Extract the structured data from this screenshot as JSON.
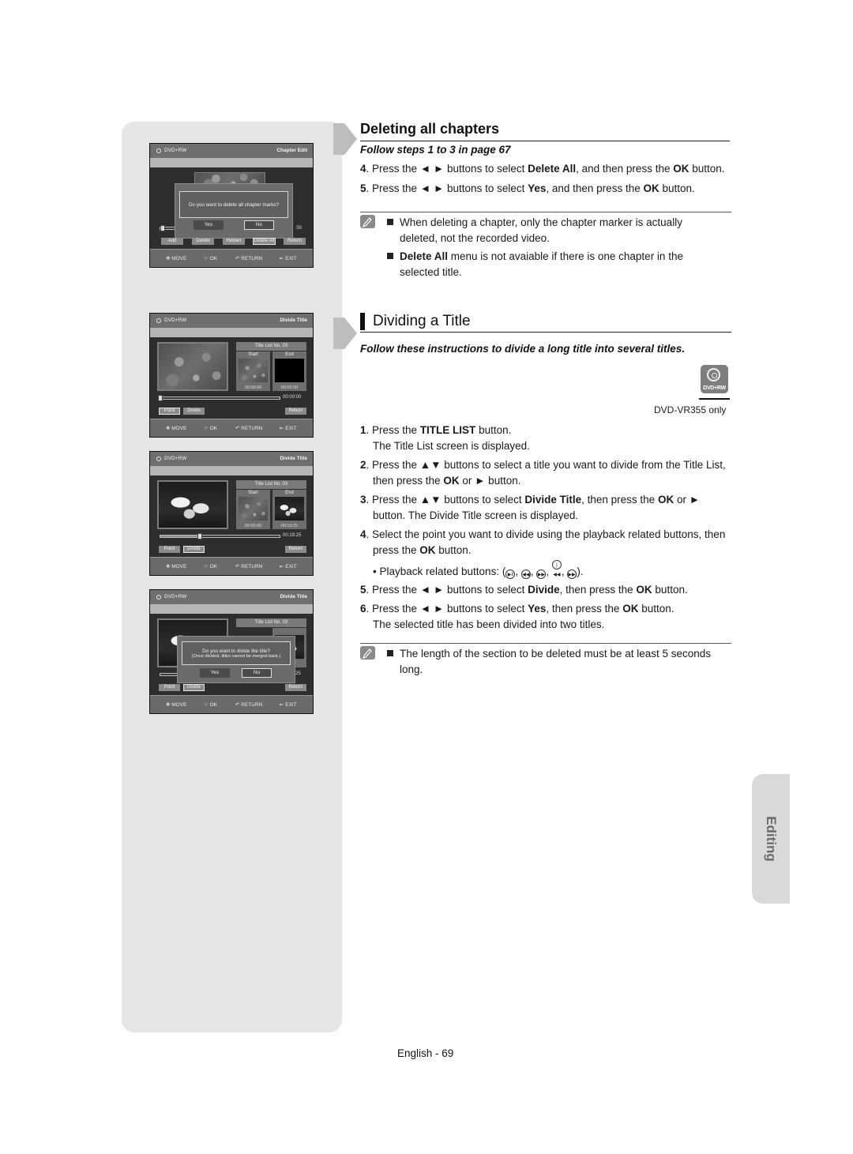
{
  "sidebar_screens": [
    {
      "disc": "DVD+RW",
      "title": "Chapter Edit",
      "dialog": {
        "message_lines": [
          "Do you want to delete all chapter marks?"
        ],
        "yes": "Yes",
        "no": "No",
        "selected": "No"
      },
      "buttons": [
        "Add",
        "Delete",
        "Hidden",
        "Delete All",
        "Return"
      ],
      "selected_button": "Delete All",
      "time_fragment": "00",
      "nav": {
        "move": "MOVE",
        "ok": "OK",
        "return": "RETURN",
        "exit": "EXIT"
      }
    },
    {
      "disc": "DVD+RW",
      "title": "Divide Title",
      "title_list": "Title List No. 03",
      "start_label": "Start",
      "end_label": "End",
      "start_time": "00:00:00",
      "end_time": "00:00:00",
      "current_time": "00:00:00",
      "progress": 0.0,
      "buttons": [
        "Point",
        "Divide",
        "Return"
      ],
      "selected_button": "Point",
      "nav": {
        "move": "MOVE",
        "ok": "OK",
        "return": "RETURN",
        "exit": "EXIT"
      }
    },
    {
      "disc": "DVD+RW",
      "title": "Divide Title",
      "title_list": "Title List No. 03",
      "start_label": "Start",
      "end_label": "End",
      "start_time": "00:00:00",
      "end_time": "00:19:25",
      "current_time": "00:19:25",
      "progress": 0.33,
      "buttons": [
        "Point",
        "Divide",
        "Return"
      ],
      "selected_button": "Divide",
      "nav": {
        "move": "MOVE",
        "ok": "OK",
        "return": "RETURN",
        "exit": "EXIT"
      }
    },
    {
      "disc": "DVD+RW",
      "title": "Divide Title",
      "title_list": "Title List No. 03",
      "dialog": {
        "message_lines": [
          "Do you want to divide the title?",
          "(Once divided, titles cannot be merged back.)"
        ],
        "yes": "Yes",
        "no": "No",
        "selected": "No"
      },
      "time_fragment": "25",
      "buttons": [
        "Point",
        "Divide",
        "Return"
      ],
      "selected_button": "Divide",
      "nav": {
        "move": "MOVE",
        "ok": "OK",
        "return": "RETURN",
        "exit": "EXIT"
      }
    }
  ],
  "section1": {
    "heading": "Deleting all chapters",
    "subheading": "Follow steps 1 to 3 in page 67",
    "steps": [
      {
        "num": "4",
        "parts": [
          [
            "t",
            "Press the ◄ ► buttons to select "
          ],
          [
            "b",
            "Delete All"
          ],
          [
            "t",
            ", and then press the "
          ],
          [
            "b",
            "OK"
          ],
          [
            "t",
            " button."
          ]
        ]
      },
      {
        "num": "5",
        "parts": [
          [
            "t",
            "Press the ◄ ► buttons to select "
          ],
          [
            "b",
            "Yes"
          ],
          [
            "t",
            ", and then press the "
          ],
          [
            "b",
            "OK"
          ],
          [
            "t",
            " button."
          ]
        ]
      }
    ],
    "notes": [
      {
        "parts": [
          [
            "t",
            "When deleting a chapter, only the chapter marker is actually deleted, not the recorded video."
          ]
        ]
      },
      {
        "parts": [
          [
            "b",
            "Delete All"
          ],
          [
            "t",
            " menu is not avaiable if there is one chapter in the selected title."
          ]
        ]
      }
    ]
  },
  "section2": {
    "heading": "Dividing a Title",
    "subheading": "Follow these instructions to divide a long title into several titles.",
    "badge_label": "DVD+RW",
    "model_note": "DVD-VR355 only",
    "steps": [
      {
        "num": "1",
        "parts": [
          [
            "t",
            "Press the "
          ],
          [
            "b",
            "TITLE LIST"
          ],
          [
            "t",
            " button."
          ],
          [
            "br",
            ""
          ],
          [
            "t",
            "The Title List screen is displayed."
          ]
        ]
      },
      {
        "num": "2",
        "parts": [
          [
            "t",
            "Press the ▲▼ buttons to select a title you want to divide from the Title List, then press the "
          ],
          [
            "b",
            "OK"
          ],
          [
            "t",
            " or ► button."
          ]
        ]
      },
      {
        "num": "3",
        "parts": [
          [
            "t",
            "Press the ▲▼ buttons to select "
          ],
          [
            "b",
            "Divide Title"
          ],
          [
            "t",
            ", then press the "
          ],
          [
            "b",
            "OK"
          ],
          [
            "t",
            " or ► button. The Divide Title screen is displayed."
          ]
        ]
      },
      {
        "num": "4",
        "parts": [
          [
            "t",
            "Select the point you want to divide using the playback related buttons, then press the "
          ],
          [
            "b",
            "OK"
          ],
          [
            "t",
            " button."
          ]
        ]
      },
      {
        "num": "5",
        "parts": [
          [
            "t",
            "Press the ◄ ► buttons to select "
          ],
          [
            "b",
            "Divide"
          ],
          [
            "t",
            ", then press the "
          ],
          [
            "b",
            "OK"
          ],
          [
            "t",
            " button."
          ]
        ]
      },
      {
        "num": "6",
        "parts": [
          [
            "t",
            "Press the ◄ ► buttons to select "
          ],
          [
            "b",
            "Yes"
          ],
          [
            "t",
            ", then press the "
          ],
          [
            "b",
            "OK"
          ],
          [
            "t",
            " button."
          ],
          [
            "br",
            ""
          ],
          [
            "t",
            "The selected title has been divided into two titles."
          ]
        ]
      }
    ],
    "playback_line": "• Playback related buttons:",
    "playback_icons": [
      {
        "name": "play-pause-icon",
        "glyph": "▶‖"
      },
      {
        "name": "rewind-icon",
        "glyph": "◀◀"
      },
      {
        "name": "fast-forward-icon",
        "glyph": "▶▶"
      },
      {
        "name": "skip-back-icon",
        "glyph": "|◀◀"
      },
      {
        "name": "skip-forward-icon",
        "glyph": "▶▶|"
      }
    ],
    "notes": [
      {
        "parts": [
          [
            "t",
            "The length of the section to be deleted must be at least 5 seconds long."
          ]
        ]
      }
    ]
  },
  "side_tab": "Editing",
  "footer": "English - 69"
}
